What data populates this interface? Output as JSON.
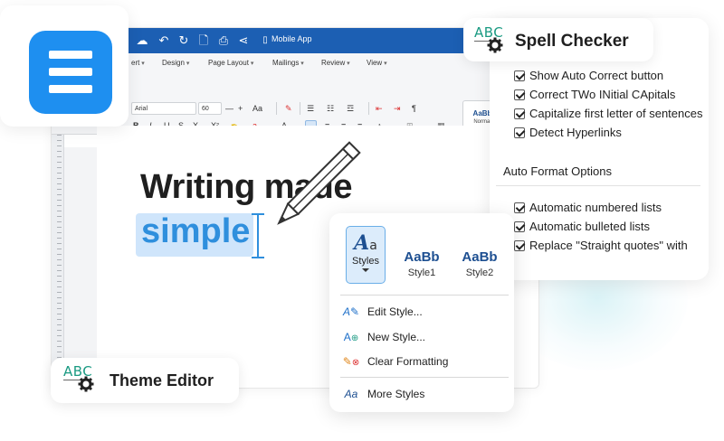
{
  "editor": {
    "doc_title": "Mobile App",
    "menu_tabs": [
      "ert",
      "Design",
      "Page Layout",
      "Mailings",
      "Review",
      "View"
    ],
    "font_name": "Arial",
    "font_size": "60",
    "aa_label": "Aa",
    "style_gallery": {
      "sample": "AaBb",
      "name": "Normal"
    },
    "heading_text": "Writing made",
    "selected_word": "simple"
  },
  "spell_checker": {
    "title": "Spell Checker",
    "abc": "ABC",
    "options": [
      {
        "label": "Show Auto Correct button",
        "checked": true
      },
      {
        "label": "Correct TWo INitial CApitals",
        "checked": true
      },
      {
        "label": "Capitalize first letter of sentences",
        "checked": true
      },
      {
        "label": "Detect Hyperlinks",
        "checked": true
      }
    ],
    "auto_format_label": "Auto Format Options",
    "auto_format_options": [
      {
        "label": "Automatic numbered lists",
        "checked": true
      },
      {
        "label": "Automatic bulleted lists",
        "checked": true
      },
      {
        "label": "Replace \"Straight quotes\" with",
        "checked": true
      }
    ]
  },
  "styles_popup": {
    "styles_button_label": "Styles",
    "styles_icon_text": "A",
    "styles_icon_small": "a",
    "samples": [
      {
        "sample": "AaBb",
        "name": "Style1"
      },
      {
        "sample": "AaBb",
        "name": "Style2"
      }
    ],
    "items": [
      "Edit Style...",
      "New Style...",
      "Clear Formatting"
    ],
    "more_styles": "More Styles",
    "more_styles_icon": "Aa"
  },
  "theme_editor": {
    "title": "Theme Editor",
    "abc": "ABC"
  },
  "colors": {
    "titlebar": "#1c5fb3",
    "accent": "#1e8ff0",
    "selection": "#cfe5fb",
    "selected_text": "#2f8fdd",
    "abc_green": "#1a9a82"
  }
}
